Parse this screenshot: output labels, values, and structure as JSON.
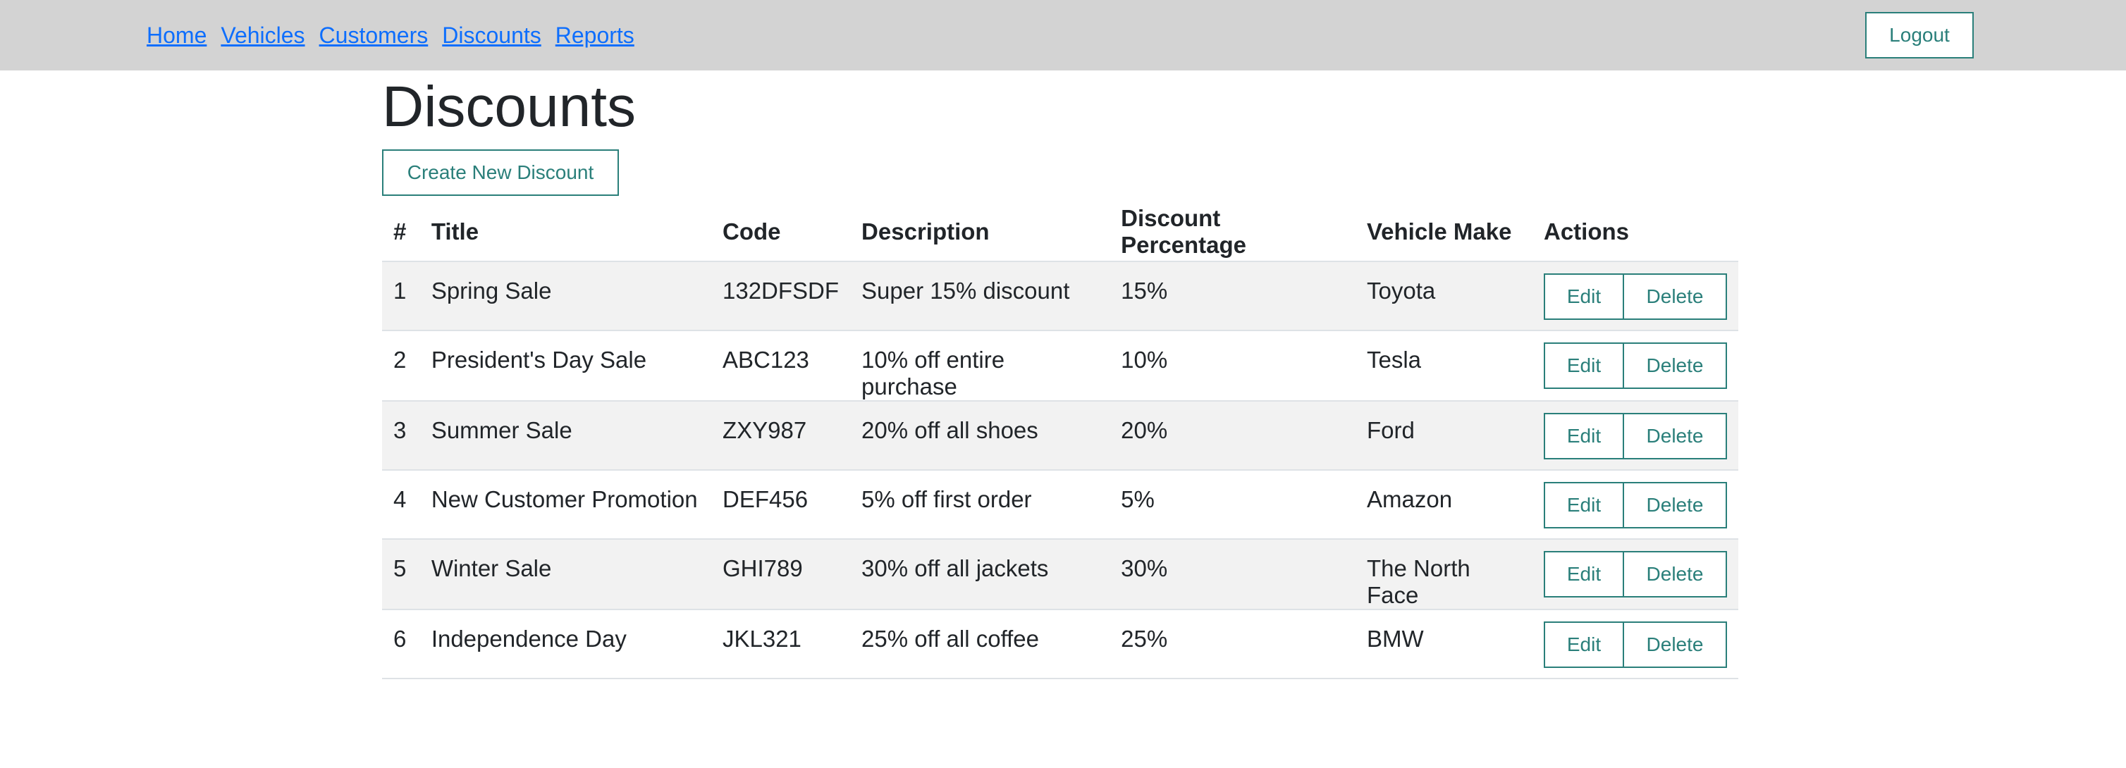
{
  "nav": {
    "links": [
      "Home",
      "Vehicles",
      "Customers",
      "Discounts",
      "Reports"
    ],
    "logout_label": "Logout"
  },
  "page": {
    "title": "Discounts",
    "create_label": "Create New Discount"
  },
  "table": {
    "headers": [
      "#",
      "Title",
      "Code",
      "Description",
      "Discount Percentage",
      "Vehicle Make",
      "Actions"
    ],
    "rows": [
      {
        "num": "1",
        "title": "Spring Sale",
        "code": "132DFSDF",
        "description": "Super 15% discount",
        "percent": "15%",
        "make": "Toyota"
      },
      {
        "num": "2",
        "title": "President's Day Sale",
        "code": "ABC123",
        "description": "10% off entire purchase",
        "percent": "10%",
        "make": "Tesla"
      },
      {
        "num": "3",
        "title": "Summer Sale",
        "code": "ZXY987",
        "description": "20% off all shoes",
        "percent": "20%",
        "make": "Ford"
      },
      {
        "num": "4",
        "title": "New Customer Promotion",
        "code": "DEF456",
        "description": "5% off first order",
        "percent": "5%",
        "make": "Amazon"
      },
      {
        "num": "5",
        "title": "Winter Sale",
        "code": "GHI789",
        "description": "30% off all jackets",
        "percent": "30%",
        "make": "The North Face"
      },
      {
        "num": "6",
        "title": "Independence Day",
        "code": "JKL321",
        "description": "25% off all coffee",
        "percent": "25%",
        "make": "BMW"
      }
    ],
    "edit_label": "Edit",
    "delete_label": "Delete"
  },
  "colors": {
    "topbar": "#d3d3d3",
    "link": "#0d6efd",
    "button_accent": "#2a7f7a",
    "striped_row": "#f2f2f2"
  }
}
